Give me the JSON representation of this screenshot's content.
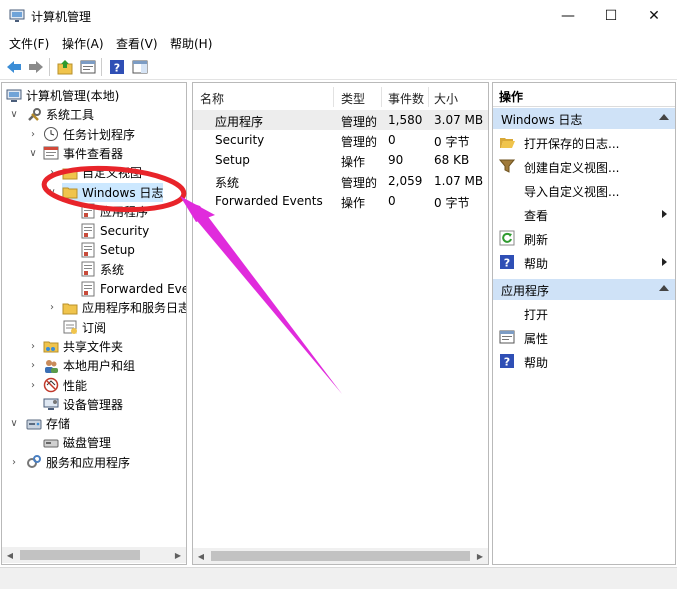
{
  "window": {
    "title": "计算机管理",
    "minimize_glyph": "—",
    "maximize_glyph": "☐",
    "close_glyph": "✕"
  },
  "menu": [
    "文件(F)",
    "操作(A)",
    "查看(V)",
    "帮助(H)"
  ],
  "toolbar": [
    "back-icon",
    "forward-icon",
    "up-folder-icon",
    "properties-icon",
    "help-icon",
    "show-action-pane-icon"
  ],
  "tree": [
    {
      "label": "计算机管理(本地)",
      "icon": "computer-management-icon",
      "expander": ""
    },
    {
      "label": "系统工具",
      "icon": "tools-icon",
      "expander": "∨"
    },
    {
      "label": "任务计划程序",
      "icon": "clock-icon",
      "expander": "›"
    },
    {
      "label": "事件查看器",
      "icon": "event-viewer-icon",
      "expander": "∨"
    },
    {
      "label": "自定义视图",
      "icon": "folder-icon",
      "expander": "›"
    },
    {
      "label": "Windows 日志",
      "icon": "folder-icon",
      "expander": "∨"
    },
    {
      "label": "应用程序",
      "icon": "log-icon",
      "expander": ""
    },
    {
      "label": "Security",
      "icon": "log-icon",
      "expander": ""
    },
    {
      "label": "Setup",
      "icon": "log-icon",
      "expander": ""
    },
    {
      "label": "系统",
      "icon": "log-icon",
      "expander": ""
    },
    {
      "label": "Forwarded Events",
      "icon": "log-icon",
      "expander": ""
    },
    {
      "label": "应用程序和服务日志",
      "icon": "folder-icon",
      "expander": "›"
    },
    {
      "label": "订阅",
      "icon": "subscription-icon",
      "expander": ""
    },
    {
      "label": "共享文件夹",
      "icon": "shared-folder-icon",
      "expander": "›"
    },
    {
      "label": "本地用户和组",
      "icon": "users-icon",
      "expander": "›"
    },
    {
      "label": "性能",
      "icon": "performance-icon",
      "expander": "›"
    },
    {
      "label": "设备管理器",
      "icon": "device-manager-icon",
      "expander": ""
    },
    {
      "label": "存储",
      "icon": "storage-icon",
      "expander": "∨"
    },
    {
      "label": "磁盘管理",
      "icon": "disk-icon",
      "expander": ""
    },
    {
      "label": "服务和应用程序",
      "icon": "services-icon",
      "expander": "›"
    }
  ],
  "list": {
    "columns": [
      "名称",
      "类型",
      "事件数",
      "大小"
    ],
    "rows": [
      [
        "应用程序",
        "管理的",
        "1,580",
        "3.07 MB"
      ],
      [
        "Security",
        "管理的",
        "0",
        "0 字节"
      ],
      [
        "Setup",
        "操作",
        "90",
        "68 KB"
      ],
      [
        "系统",
        "管理的",
        "2,059",
        "1.07 MB"
      ],
      [
        "Forwarded Events",
        "操作",
        "0",
        "0 字节"
      ]
    ]
  },
  "actions": {
    "title": "操作",
    "groups": [
      {
        "label": "Windows 日志",
        "items": [
          {
            "label": "打开保存的日志...",
            "icon": "open-folder-icon",
            "submenu": false
          },
          {
            "label": "创建自定义视图...",
            "icon": "filter-icon",
            "submenu": false
          },
          {
            "label": "导入自定义视图...",
            "icon": "",
            "submenu": false
          },
          {
            "label": "查看",
            "icon": "",
            "submenu": true
          },
          {
            "label": "刷新",
            "icon": "refresh-icon",
            "submenu": false
          },
          {
            "label": "帮助",
            "icon": "help-icon",
            "submenu": true
          }
        ]
      },
      {
        "label": "应用程序",
        "items": [
          {
            "label": "打开",
            "icon": "",
            "submenu": false
          },
          {
            "label": "属性",
            "icon": "properties-icon",
            "submenu": false
          },
          {
            "label": "帮助",
            "icon": "help-icon",
            "submenu": false
          }
        ]
      }
    ]
  },
  "colors": {
    "selection": "#cce8ff",
    "action_group": "#cfe2f7",
    "annotation_red": "#e8242a",
    "annotation_arrow": "#e02bdc",
    "help_blue": "#2f4fb5",
    "folder_yellow": "#f0c44c"
  }
}
